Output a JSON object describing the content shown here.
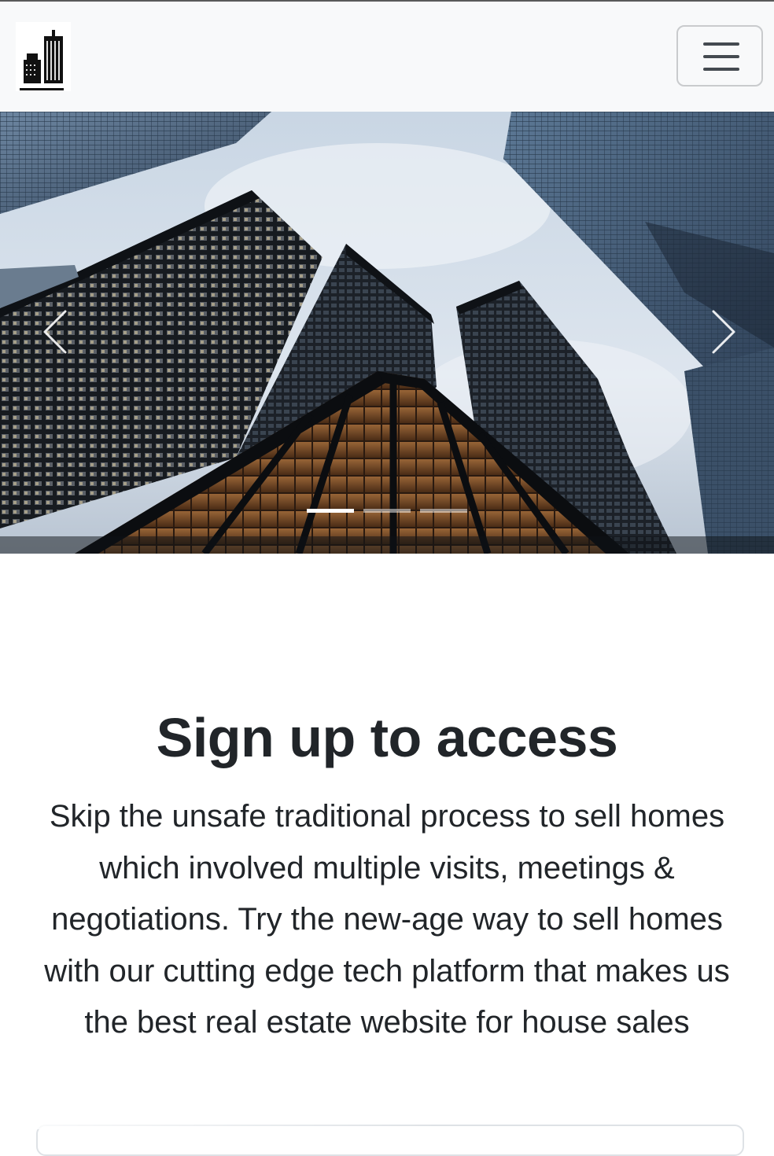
{
  "navbar": {
    "logo_icon": "buildings-logo-icon",
    "toggler_icon": "hamburger-menu-icon"
  },
  "carousel": {
    "prev_icon": "chevron-left-icon",
    "next_icon": "chevron-right-icon",
    "slide_count": 3,
    "active_slide": 1
  },
  "signup": {
    "title": "Sign up to access",
    "lead": "Skip the unsafe traditional process to sell homes which involved multiple visits, meetings & negotiations. Try the new-age way to sell homes with our cutting edge tech platform that makes us the best real estate website for house sales"
  },
  "colors": {
    "navbar_bg": "#f8f9fa",
    "text": "#212529",
    "indicator_active": "#ffffff"
  }
}
